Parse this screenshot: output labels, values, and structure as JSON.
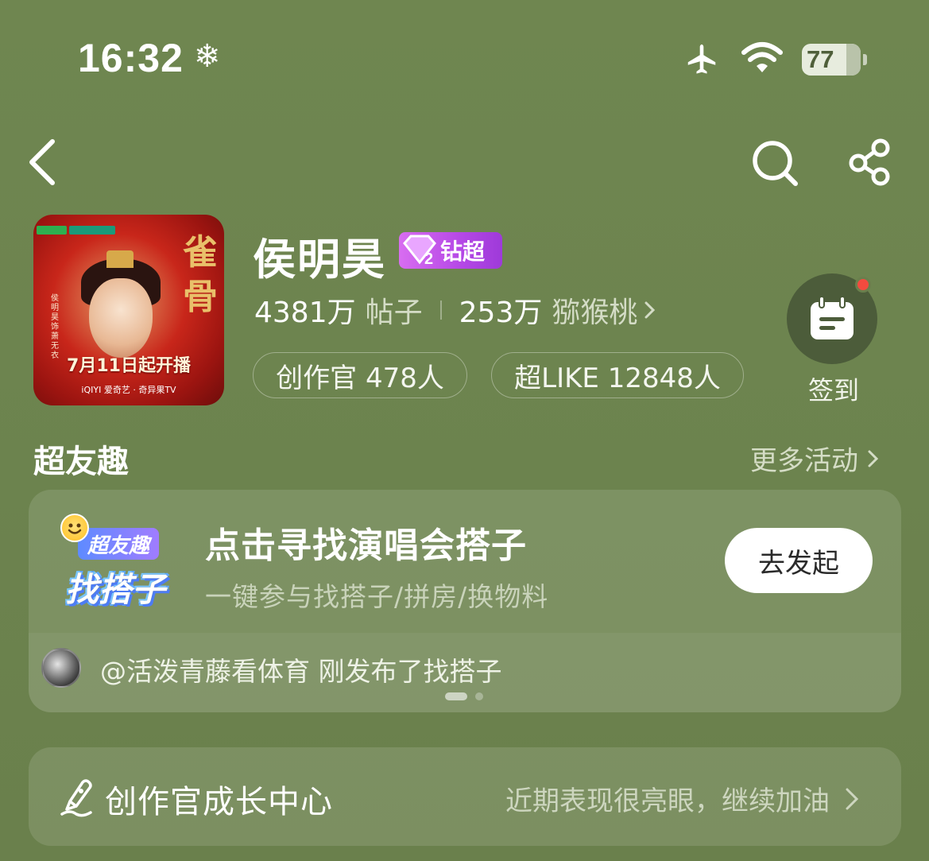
{
  "status_bar": {
    "time": "16:32",
    "snow_glyph": "❄",
    "battery": "77",
    "icons": [
      "airplane-icon",
      "wifi-icon",
      "battery-icon"
    ]
  },
  "nav": {
    "icons": [
      "back-chevron-icon",
      "search-icon",
      "share-icon"
    ]
  },
  "cover": {
    "title_art": "雀骨",
    "side_text": "侯明昊 饰 萧无衣",
    "date_text": "7月11日起开播",
    "brand_text": "iQIYI 爱奇艺 · 奇异果TV"
  },
  "profile": {
    "name": "侯明昊",
    "badge_level": "2",
    "badge_label": "钻超",
    "posts_count": "4381万",
    "posts_label": "帖子",
    "fans_count": "253万",
    "fans_label": "猕猴桃",
    "creator_pill": "创作官 478人",
    "like_pill": "超LIKE 12848人",
    "checkin_label": "签到"
  },
  "section": {
    "title": "超友趣",
    "more_label": "更多活动"
  },
  "activity": {
    "logo_top": "超友趣",
    "logo_bottom": "找搭子",
    "title": "点击寻找演唱会搭子",
    "subtitle": "一键参与找搭子/拼房/换物料",
    "button_label": "去发起",
    "ticker": "@活泼青藤看体育 刚发布了找搭子",
    "pagination": {
      "total": 2,
      "active": 1
    }
  },
  "growth": {
    "title": "创作官成长中心",
    "hint": "近期表现很亮眼，继续加油"
  },
  "colors": {
    "background": "#6d844f",
    "badge": "#b548e6",
    "notification_dot": "#f24b3f",
    "button_bg": "#ffffff"
  }
}
